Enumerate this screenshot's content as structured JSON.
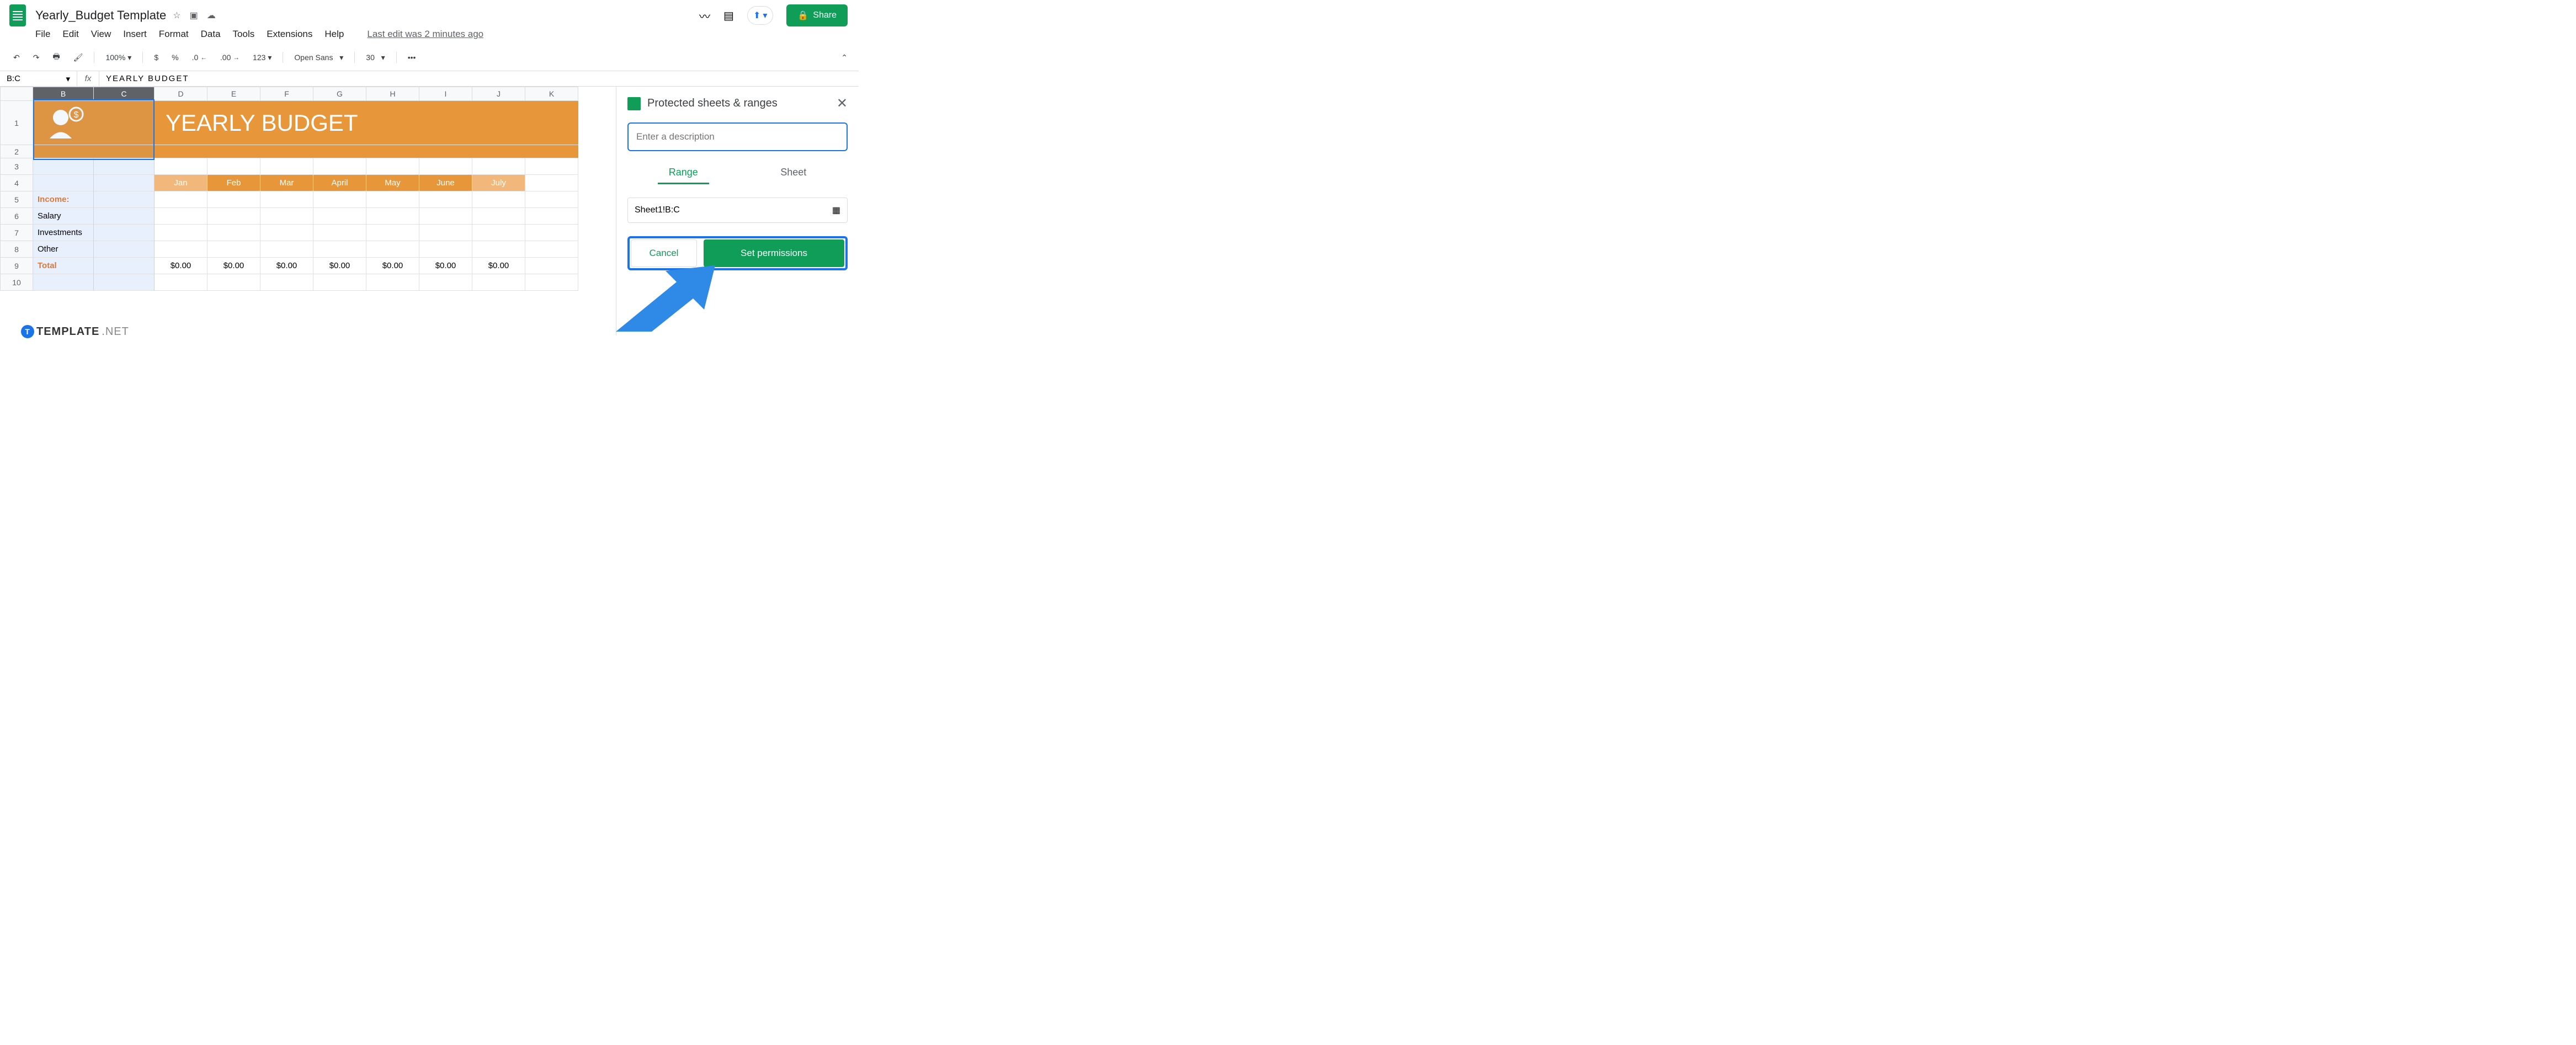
{
  "doc": {
    "title": "Yearly_Budget Template",
    "last_edit": "Last edit was 2 minutes ago"
  },
  "menu": {
    "file": "File",
    "edit": "Edit",
    "view": "View",
    "insert": "Insert",
    "format": "Format",
    "data": "Data",
    "tools": "Tools",
    "extensions": "Extensions",
    "help": "Help"
  },
  "share": {
    "label": "Share"
  },
  "toolbar": {
    "zoom": "100%",
    "dollar": "$",
    "percent": "%",
    "dec_dec": ".0",
    "inc_dec": ".00",
    "fmt123": "123",
    "font": "Open Sans",
    "size": "30",
    "more": "•••"
  },
  "formula": {
    "name_box": "B:C",
    "value": "YEARLY  BUDGET"
  },
  "cols": [
    "B",
    "C",
    "D",
    "E",
    "F",
    "G",
    "H",
    "I",
    "J",
    "K"
  ],
  "rows": [
    "1",
    "2",
    "3",
    "4",
    "5",
    "6",
    "7",
    "8",
    "9",
    "10"
  ],
  "sheet": {
    "banner": "YEARLY  BUDGET",
    "months": [
      "Jan",
      "Feb",
      "Mar",
      "April",
      "May",
      "June",
      "July"
    ],
    "income_label": "Income:",
    "items": [
      "Salary",
      "Investments",
      "Other"
    ],
    "total_label": "Total",
    "zero": "$0.00"
  },
  "sidebar": {
    "title": "Protected sheets & ranges",
    "desc_placeholder": "Enter a description",
    "tab_range": "Range",
    "tab_sheet": "Sheet",
    "range_value": "Sheet1!B:C",
    "cancel": "Cancel",
    "set": "Set permissions"
  },
  "watermark": {
    "brand": "TEMPLATE",
    "tld": ".NET"
  }
}
